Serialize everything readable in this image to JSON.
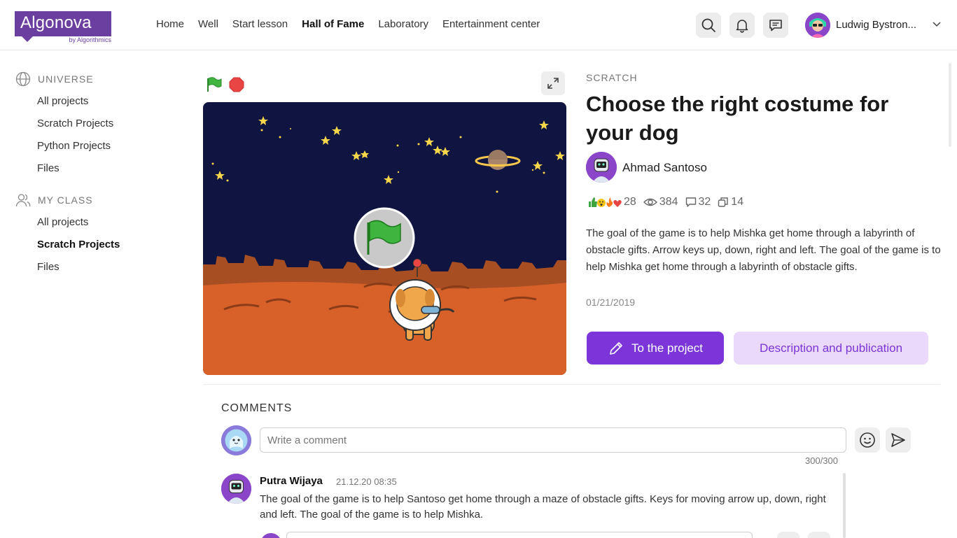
{
  "header": {
    "logo_text": "Algonova",
    "logo_sub": "by Algorithmics",
    "nav": [
      {
        "label": "Home",
        "active": false
      },
      {
        "label": "Well",
        "active": false
      },
      {
        "label": "Start lesson",
        "active": false
      },
      {
        "label": "Hall of Fame",
        "active": true
      },
      {
        "label": "Laboratory",
        "active": false
      },
      {
        "label": "Entertainment center",
        "active": false
      }
    ],
    "user_name": "Ludwig Bystron..."
  },
  "sidebar": {
    "universe": {
      "title": "UNIVERSE",
      "items": [
        "All projects",
        "Scratch Projects",
        "Python Projects",
        "Files"
      ]
    },
    "my_class": {
      "title": "MY CLASS",
      "items": [
        "All projects",
        "Scratch Projects",
        "Files"
      ],
      "active_index": 1
    }
  },
  "project": {
    "category": "SCRATCH",
    "title": "Choose the right costume for your dog",
    "author": "Ahmad Santoso",
    "stats": {
      "reactions": "28",
      "views": "384",
      "comments": "32",
      "copies": "14"
    },
    "description": "The goal of the game is to help Mishka get home through a labyrinth of obstacle gifts. Arrow keys up, down, right and left. The goal of the game is to help Mishka get home through a labyrinth of obstacle gifts.",
    "date": "01/21/2019",
    "primary_button": "To the project",
    "secondary_button": "Description and publication"
  },
  "comments": {
    "title": "COMMENTS",
    "input_placeholder": "Write a comment",
    "counter": "300/300",
    "items": [
      {
        "author": "Putra Wijaya",
        "time": "21.12.20 08:35",
        "text": "The goal of the game is to help Santoso get home through a maze of obstacle gifts. Keys for moving arrow up, down, right and left. The goal of the game is to help Mishka."
      }
    ]
  },
  "colors": {
    "brand": "#6b3fa0",
    "accent": "#7b35d8",
    "accent_light": "#ead9fb",
    "stage_sky": "#0f1440",
    "stage_ground": "#d8612a"
  }
}
